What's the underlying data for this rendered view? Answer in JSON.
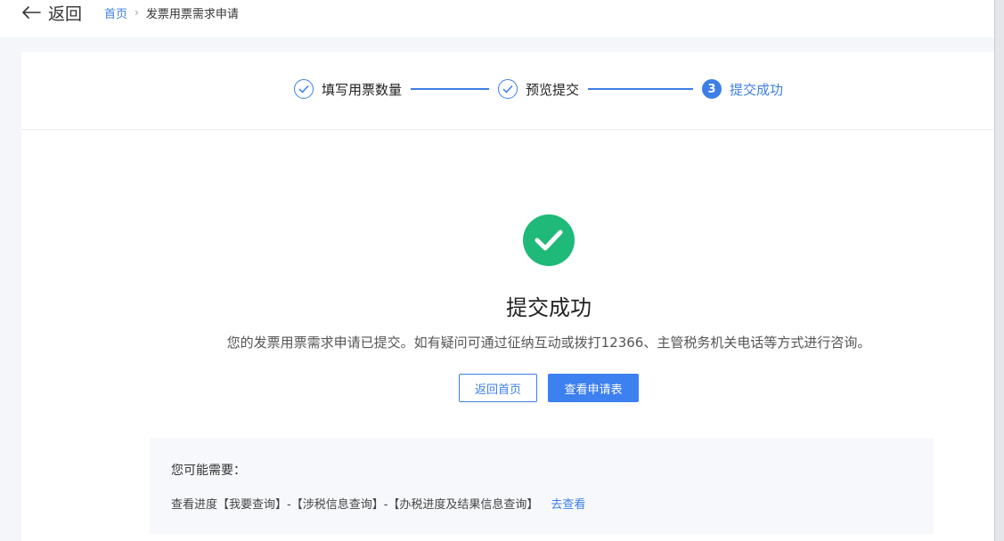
{
  "header": {
    "back_label": "返回",
    "breadcrumb": {
      "home": "首页",
      "separator": "›",
      "current": "发票用票需求申请"
    }
  },
  "steps": [
    {
      "label": "填写用票数量",
      "state": "done"
    },
    {
      "label": "预览提交",
      "state": "done"
    },
    {
      "label": "提交成功",
      "state": "active",
      "number": "3"
    }
  ],
  "result": {
    "title": "提交成功",
    "description": "您的发票用票需求申请已提交。如有疑问可通过征纳互动或拨打12366、主管税务机关电话等方式进行咨询。",
    "buttons": {
      "home": "返回首页",
      "view": "查看申请表"
    }
  },
  "hint": {
    "title": "您可能需要：",
    "path": "查看进度【我要查询】-【涉税信息查询】-【办税进度及结果信息查询】",
    "link": "去查看"
  },
  "colors": {
    "accent": "#3d7fe6",
    "success": "#1fb97a",
    "background": "#f4f6f9"
  },
  "icons": {
    "back": "arrow-left-icon",
    "done_step": "check-circle-icon",
    "success": "success-check-icon"
  }
}
